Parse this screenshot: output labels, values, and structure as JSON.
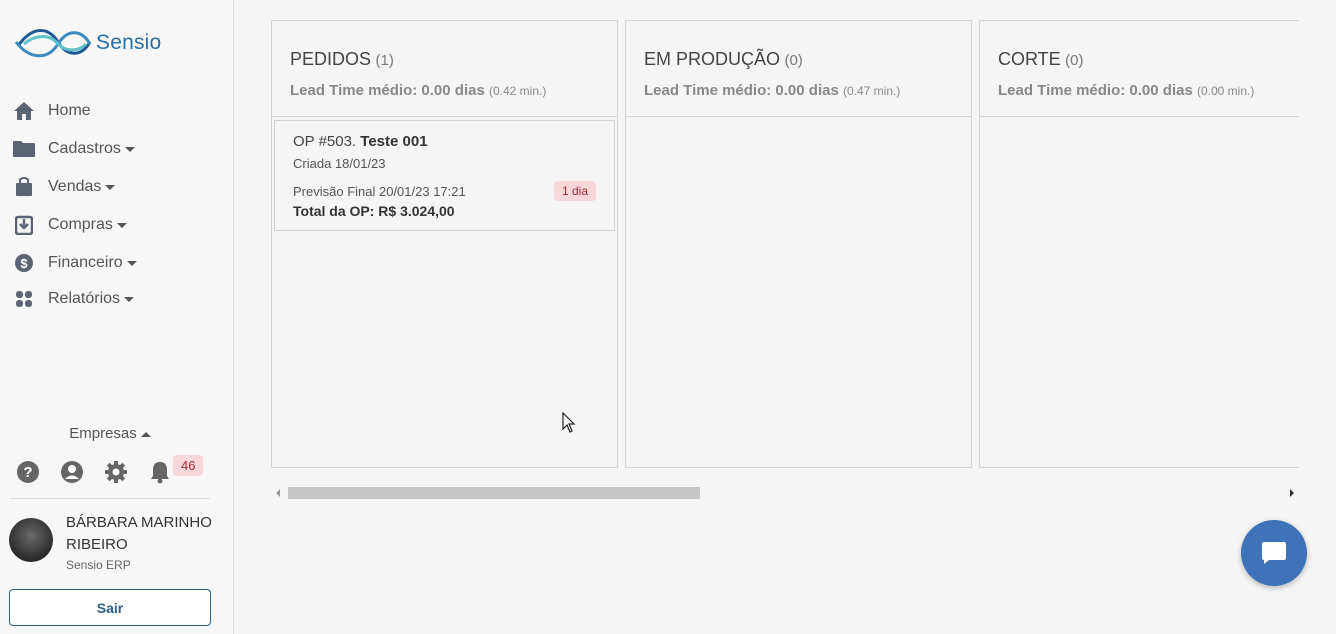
{
  "brand": {
    "name": "Sensio",
    "logo_icon": "sensio-logo-icon",
    "accent": "#2a6fa5"
  },
  "nav": [
    {
      "label": "Home",
      "icon": "home-icon",
      "dropdown": false
    },
    {
      "label": "Cadastros",
      "icon": "folder-icon",
      "dropdown": true
    },
    {
      "label": "Vendas",
      "icon": "shopping-bag-icon",
      "dropdown": true
    },
    {
      "label": "Compras",
      "icon": "inbox-download-icon",
      "dropdown": true
    },
    {
      "label": "Financeiro",
      "icon": "dollar-icon",
      "dropdown": true
    },
    {
      "label": "Relatórios",
      "icon": "grid-icon",
      "dropdown": true
    }
  ],
  "empresas": {
    "label": "Empresas"
  },
  "notifications": {
    "count": "46",
    "badge_color": "#f8d7da"
  },
  "user": {
    "name": "BÁRBARA MARINHO RIBEIRO",
    "company": "Sensio ERP"
  },
  "logout": {
    "label": "Sair"
  },
  "columns": [
    {
      "title": "PEDIDOS",
      "count": "(1)",
      "lead_label": "Lead Time médio: 0.00 dias",
      "lead_min": "(0.42 min.)",
      "cards": [
        {
          "op": "OP #503.",
          "name": "Teste 001",
          "created": "Criada 18/01/23",
          "forecast": "Previsão Final 20/01/23 17:21",
          "badge": "1 dia",
          "total": "Total da OP: R$ 3.024,00"
        }
      ]
    },
    {
      "title": "EM PRODUÇÃO",
      "count": "(0)",
      "lead_label": "Lead Time médio: 0.00 dias",
      "lead_min": "(0.47 min.)",
      "cards": []
    },
    {
      "title": "CORTE",
      "count": "(0)",
      "lead_label": "Lead Time médio: 0.00 dias",
      "lead_min": "(0.00 min.)",
      "cards": []
    }
  ],
  "chat": {
    "icon": "chat-bubble-icon",
    "color": "#3f73b8"
  }
}
